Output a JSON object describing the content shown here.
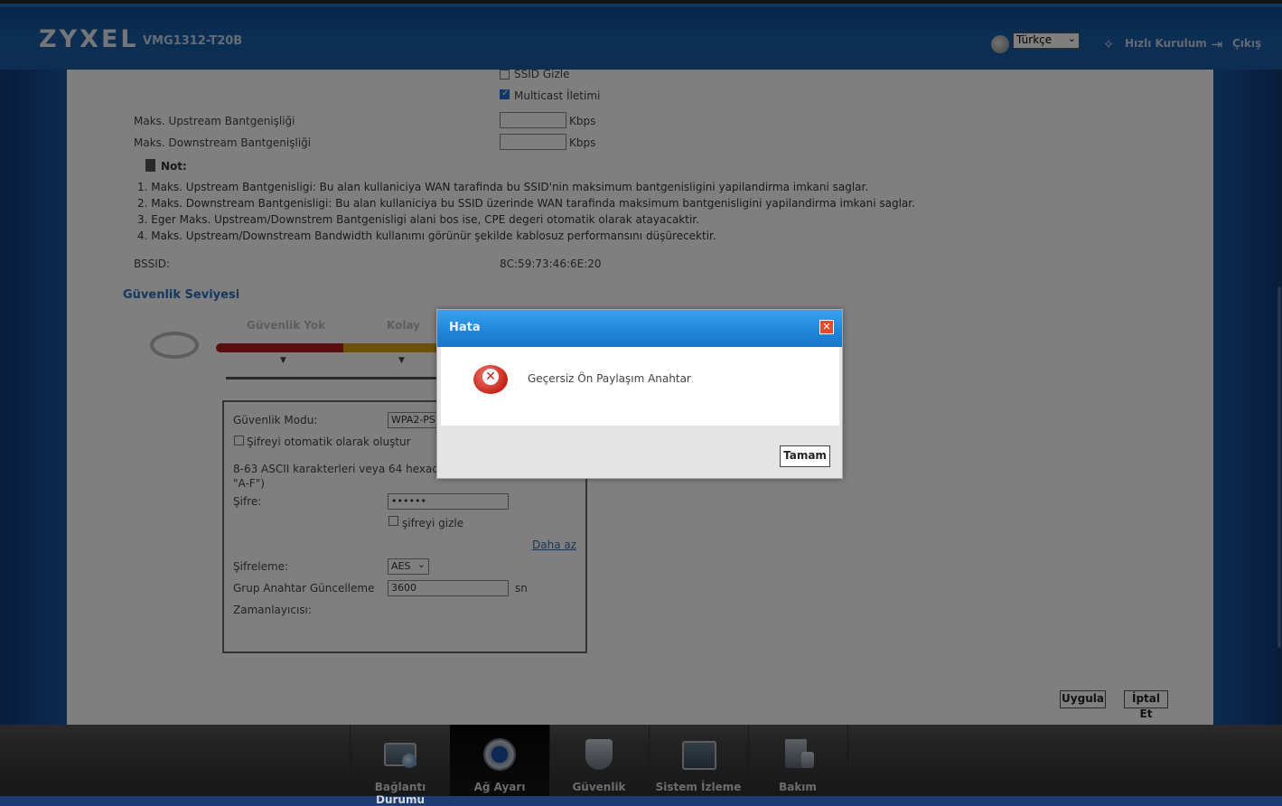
{
  "header": {
    "brand": "ZYXEL",
    "model": "VMG1312-T20B",
    "language": "Türkçe",
    "quick_setup": "Hızlı Kurulum",
    "logout": "Çıkış"
  },
  "form": {
    "ssid_hide": "SSID Gizle",
    "multicast": "Multicast İletimi",
    "upstream_label": "Maks. Upstream Bantgenişliği",
    "downstream_label": "Maks. Downstream Bantgenişliği",
    "unit_kbps": "Kbps",
    "note_title": "Not:",
    "notes": [
      "1. Maks. Upstream Bantgenisligi: Bu alan kullaniciya WAN tarafinda bu SSID'nin maksimum bantgenisligini yapilandirma imkani saglar.",
      "2. Maks. Downstream Bantgenisligi: Bu alan kullaniciya bu SSID üzerinde WAN tarafinda maksimum bantgenisligini yapilandirma imkani saglar.",
      "3. Eger Maks. Upstream/Downstrem Bantgenisligi alani bos ise, CPE degeri otomatik olarak atayacaktir.",
      "4. Maks. Upstream/Downstream Bandwidth kullanımı görünür şekilde kablosuz performansını düşürecektir."
    ],
    "bssid_label": "BSSID:",
    "bssid_value": "8C:59:73:46:6E:20"
  },
  "security": {
    "section_title": "Güvenlik Seviyesi",
    "level_none": "Güvenlik Yok",
    "level_easy": "Kolay",
    "mode_label": "Güvenlik Modu:",
    "mode_value": "WPA2-PS",
    "auto_password": "Şifreyi otomatik olarak oluştur",
    "hint_line1": "8-63 ASCII karakterleri veya 64 hexade",
    "hint_line2": "\"A-F\")",
    "password_label": "Şifre:",
    "password_value": "••••••",
    "hide_password": "şifreyi gizle",
    "less_link": "Daha az",
    "encryption_label": "Şifreleme:",
    "encryption_value": "AES",
    "group_key_label": "Grup Anahtar Güncelleme",
    "group_key_label2": "Zamanlayıcısı:",
    "group_key_value": "3600",
    "unit_sn": "sn"
  },
  "actions": {
    "apply": "Uygula",
    "cancel": "İptal Et"
  },
  "dialog": {
    "title": "Hata",
    "message": "Geçersiz Ön Paylaşım Anahtar",
    "ok": "Tamam",
    "close": "✕"
  },
  "nav": [
    {
      "label": "Bağlantı Durumu"
    },
    {
      "label": "Ağ Ayarı"
    },
    {
      "label": "Güvenlik"
    },
    {
      "label": "Sistem İzleme"
    },
    {
      "label": "Bakım"
    }
  ],
  "colors": {
    "accent": "#2f6fb8",
    "dialog_title": "#1f84d8",
    "meter_red": "#b51f1f",
    "meter_yellow": "#d8a21a"
  }
}
